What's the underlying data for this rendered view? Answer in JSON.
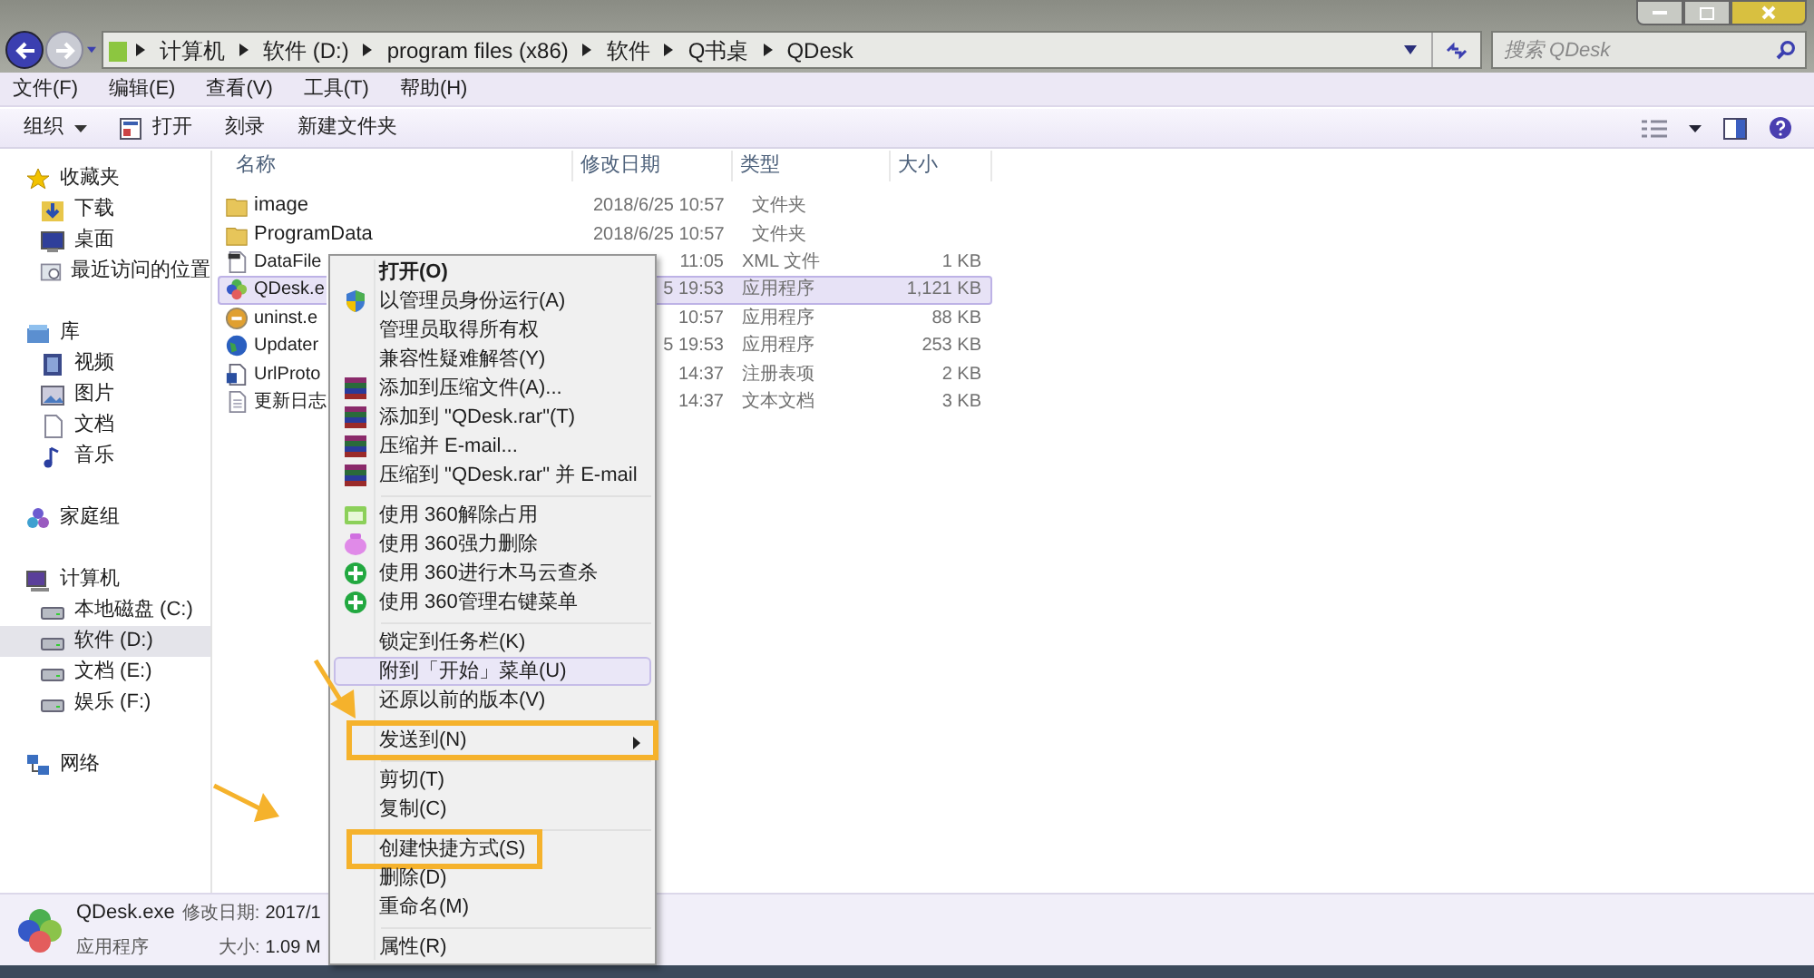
{
  "address_bar": {
    "crumbs": [
      "计算机",
      "软件 (D:)",
      "program files (x86)",
      "软件",
      "Q书桌",
      "QDesk"
    ]
  },
  "search": {
    "placeholder": "搜索 QDesk"
  },
  "menu_bar": [
    "文件(F)",
    "编辑(E)",
    "查看(V)",
    "工具(T)",
    "帮助(H)"
  ],
  "toolbar": [
    {
      "label": "组织",
      "kind": "dropdown"
    },
    {
      "label": "打开",
      "kind": "icon"
    },
    {
      "label": "刻录",
      "kind": "plain"
    },
    {
      "label": "新建文件夹",
      "kind": "plain"
    }
  ],
  "sidebar": {
    "groups": [
      {
        "label": "收藏夹",
        "children": [
          {
            "label": "下载",
            "selected": false
          },
          {
            "label": "桌面",
            "selected": false
          },
          {
            "label": "最近访问的位置",
            "selected": false
          }
        ]
      },
      {
        "label": "库",
        "children": [
          {
            "label": "视频",
            "selected": false
          },
          {
            "label": "图片",
            "selected": false
          },
          {
            "label": "文档",
            "selected": false
          },
          {
            "label": "音乐",
            "selected": false
          }
        ]
      },
      {
        "label": "家庭组"
      },
      {
        "label": "计算机",
        "children": [
          {
            "label": "本地磁盘 (C:)",
            "selected": false
          },
          {
            "label": "软件 (D:)",
            "selected": true
          },
          {
            "label": "文档 (E:)",
            "selected": false
          },
          {
            "label": "娱乐 (F:)",
            "selected": false
          }
        ]
      },
      {
        "label": "网络"
      }
    ]
  },
  "table": {
    "columns": [
      "名称",
      "修改日期",
      "类型",
      "大小"
    ],
    "rows": [
      {
        "name": "image",
        "date": "2018/6/25 10:57",
        "type": "文件夹",
        "selected": false
      },
      {
        "name": "ProgramData",
        "date": "2018/6/25 10:57",
        "type": "文件夹",
        "selected": false
      },
      {
        "name": "DataFile",
        "date": "11:05",
        "type": "XML 文件",
        "size": "1 KB",
        "selected": false
      },
      {
        "name": "QDesk.e",
        "date": "5 19:53",
        "type": "应用程序",
        "size": "1,121 KB",
        "selected": true
      },
      {
        "name": "uninst.e",
        "date": "10:57",
        "type": "应用程序",
        "size": "88 KB",
        "selected": false
      },
      {
        "name": "Updater",
        "date": "5 19:53",
        "type": "应用程序",
        "size": "253 KB",
        "selected": false
      },
      {
        "name": "UrlProto",
        "date": "14:37",
        "type": "注册表项",
        "size": "2 KB",
        "selected": false
      },
      {
        "name": "更新日志",
        "date": "14:37",
        "type": "文本文档",
        "size": "3 KB",
        "selected": false
      }
    ]
  },
  "context_menu": {
    "groups": [
      [
        {
          "label": "打开(O)",
          "default": true,
          "hovered": false,
          "submenu": false,
          "marked": false
        },
        {
          "label": "以管理员身份运行(A)",
          "default": false,
          "hovered": false,
          "submenu": false,
          "marked": false
        },
        {
          "label": "管理员取得所有权",
          "default": false,
          "hovered": false,
          "submenu": false,
          "marked": false
        },
        {
          "label": "兼容性疑难解答(Y)",
          "default": false,
          "hovered": false,
          "submenu": false,
          "marked": false
        },
        {
          "label": "添加到压缩文件(A)...",
          "default": false,
          "hovered": false,
          "submenu": false,
          "marked": false
        },
        {
          "label": "添加到 \"QDesk.rar\"(T)",
          "default": false,
          "hovered": false,
          "submenu": false,
          "marked": false
        },
        {
          "label": "压缩并 E-mail...",
          "default": false,
          "hovered": false,
          "submenu": false,
          "marked": false
        },
        {
          "label": "压缩到 \"QDesk.rar\" 并 E-mail",
          "default": false,
          "hovered": false,
          "submenu": false,
          "marked": false
        }
      ],
      [
        {
          "label": "使用 360解除占用",
          "default": false,
          "hovered": false,
          "submenu": false,
          "marked": false
        },
        {
          "label": "使用 360强力删除",
          "default": false,
          "hovered": false,
          "submenu": false,
          "marked": false
        },
        {
          "label": "使用 360进行木马云查杀",
          "default": false,
          "hovered": false,
          "submenu": false,
          "marked": false
        },
        {
          "label": "使用 360管理右键菜单",
          "default": false,
          "hovered": false,
          "submenu": false,
          "marked": false
        }
      ],
      [
        {
          "label": "锁定到任务栏(K)",
          "default": false,
          "hovered": false,
          "submenu": false,
          "marked": false
        },
        {
          "label": "附到「开始」菜单(U)",
          "default": false,
          "hovered": true,
          "submenu": false,
          "marked": false
        },
        {
          "label": "还原以前的版本(V)",
          "default": false,
          "hovered": false,
          "submenu": false,
          "marked": false
        }
      ],
      [
        {
          "label": "发送到(N)",
          "default": false,
          "hovered": false,
          "submenu": true,
          "marked": true
        }
      ],
      [
        {
          "label": "剪切(T)",
          "default": false,
          "hovered": false,
          "submenu": false,
          "marked": false
        },
        {
          "label": "复制(C)",
          "default": false,
          "hovered": false,
          "submenu": false,
          "marked": false
        }
      ],
      [
        {
          "label": "创建快捷方式(S)",
          "default": false,
          "hovered": false,
          "submenu": false,
          "marked": true
        },
        {
          "label": "删除(D)",
          "default": false,
          "hovered": false,
          "submenu": false,
          "marked": false
        },
        {
          "label": "重命名(M)",
          "default": false,
          "hovered": false,
          "submenu": false,
          "marked": false
        }
      ],
      [
        {
          "label": "属性(R)",
          "default": false,
          "hovered": false,
          "submenu": false,
          "marked": false
        }
      ]
    ]
  },
  "details_pane": {
    "name": "QDesk.exe",
    "type": "应用程序",
    "fields": [
      {
        "label": "修改日期:",
        "value": "2017/1"
      },
      {
        "label": "大小:",
        "value": "1.09 M"
      }
    ]
  }
}
